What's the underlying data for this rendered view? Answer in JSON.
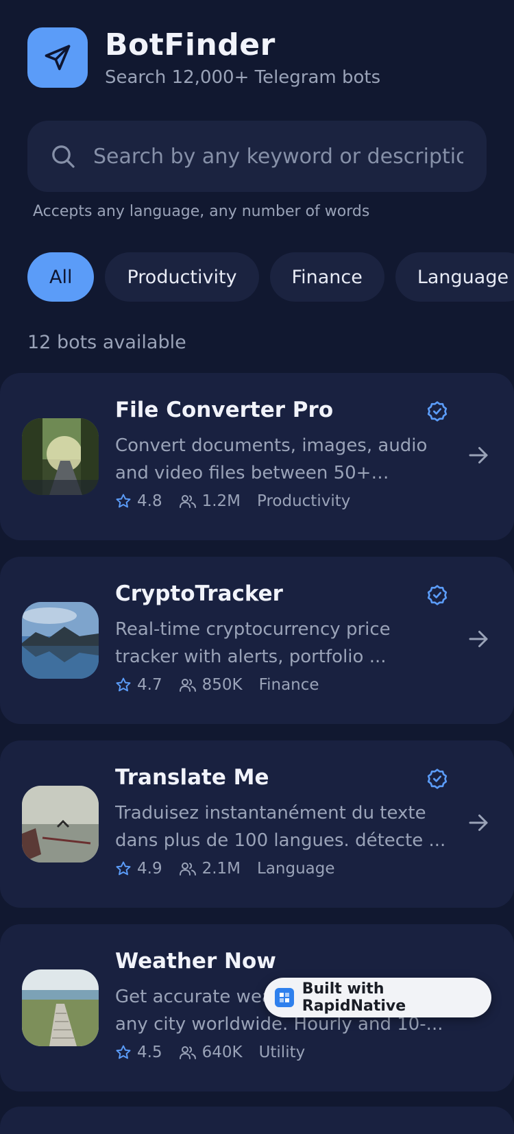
{
  "header": {
    "title": "BotFinder",
    "subtitle": "Search 12,000+ Telegram bots",
    "logo_icon": "paper-plane-icon"
  },
  "search": {
    "placeholder": "Search by any keyword or descriptio",
    "hint": "Accepts any language, any number of words"
  },
  "categories": [
    {
      "label": "All",
      "active": true
    },
    {
      "label": "Productivity",
      "active": false
    },
    {
      "label": "Finance",
      "active": false
    },
    {
      "label": "Language",
      "active": false
    }
  ],
  "count_label": "12 bots available",
  "bots": [
    {
      "name": "File Converter Pro",
      "description": "Convert documents, images, audio and video files between 50+ format...",
      "rating": "4.8",
      "users": "1.2M",
      "category": "Productivity",
      "verified": true
    },
    {
      "name": "CryptoTracker",
      "description": "Real-time cryptocurrency price tracker with alerts, portfolio ...",
      "rating": "4.7",
      "users": "850K",
      "category": "Finance",
      "verified": true
    },
    {
      "name": "Translate Me",
      "description": "Traduisez instantanément du texte dans plus de 100 langues. détecte ...",
      "rating": "4.9",
      "users": "2.1M",
      "category": "Language",
      "verified": true
    },
    {
      "name": "Weather Now",
      "description": "Get accurate weather forecasts for any city worldwide. Hourly and 10-...",
      "rating": "4.5",
      "users": "640K",
      "category": "Utility",
      "verified": false
    }
  ],
  "badge": {
    "label": "Built with RapidNative"
  },
  "colors": {
    "background": "#111830",
    "card": "#192140",
    "accent": "#5b9cf8",
    "muted_text": "#9aa3b8"
  }
}
